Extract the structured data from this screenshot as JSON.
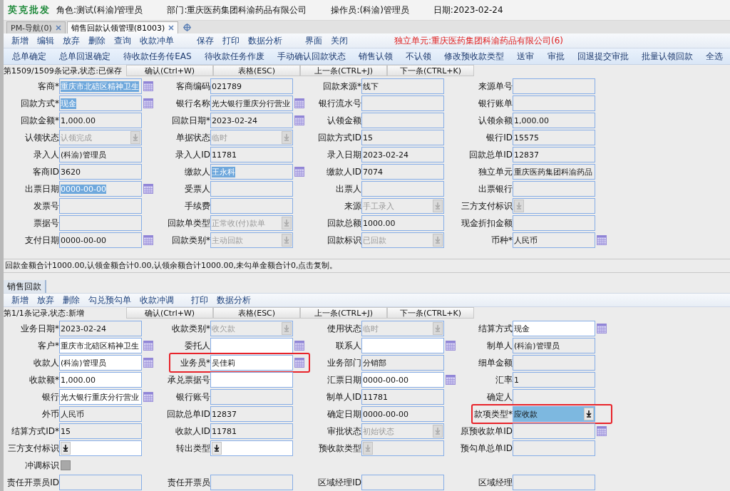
{
  "header": {
    "brand": "英克批发",
    "items": [
      "角色:测试(科渝)管理员",
      "部门:重庆医药集团科渝药品有限公司",
      "操作员:(科渝)管理员",
      "日期:2023-02-24"
    ]
  },
  "tabs": [
    {
      "label": "PM-导航(0)",
      "selected": false
    },
    {
      "label": "销售回款认领管理(81003)",
      "selected": true
    }
  ],
  "toolbar": {
    "groups": [
      [
        "新增",
        "编辑",
        "放弃",
        "删除",
        "查询",
        "收款冲单"
      ],
      [
        "保存",
        "打印",
        "数据分析"
      ],
      [
        "界面",
        "关闭"
      ]
    ],
    "notice": "独立单元:重庆医药集团科渝药品有限公司(6)"
  },
  "actions": [
    "总单确定",
    "总单回退确定",
    "待收款任务传EAS",
    "待收款任务作废",
    "手动确认回款状态",
    "销售认领",
    "不认领",
    "修改预收款类型",
    "送审",
    "审批",
    "回退提交审批",
    "批量认领回款",
    "全选"
  ],
  "record_bar": {
    "status": "第1509/1509条记录,状态:已保存",
    "buttons": [
      "确认(Ctrl+W)",
      "表格(ESC)",
      "上一条(CTRL+J)",
      "下一条(CTRL+K)"
    ]
  },
  "upper_form": {
    "rows": [
      [
        {
          "label": "客商*",
          "value": "重庆市北碚区精神卫生",
          "kind": "text",
          "editable": false,
          "highlighted": true,
          "picker": true
        },
        {
          "label": "客商编码",
          "value": "021789",
          "kind": "text",
          "editable": false
        },
        {
          "label": "回款来源*",
          "value": "线下",
          "kind": "text",
          "editable": false
        },
        {
          "label": "来源单号",
          "kind": "text",
          "editable": false
        }
      ],
      [
        {
          "label": "回款方式*",
          "value": "现金",
          "kind": "text",
          "editable": false,
          "highlighted": true,
          "picker": true
        },
        {
          "label": "银行名称",
          "value": "光大银行重庆分行营业",
          "kind": "text",
          "editable": false,
          "picker": true
        },
        {
          "label": "银行流水号",
          "kind": "text",
          "editable": false
        },
        {
          "label": "银行账单",
          "kind": "text",
          "editable": false
        }
      ],
      [
        {
          "label": "回款金额*",
          "value": "1,000.00",
          "kind": "text",
          "editable": false
        },
        {
          "label": "回款日期*",
          "value": "2023-02-24",
          "kind": "text",
          "editable": false,
          "picker": true
        },
        {
          "label": "认领金额",
          "kind": "text",
          "editable": false
        },
        {
          "label": "认领余额",
          "value": "1,000.00",
          "kind": "text",
          "editable": false
        }
      ],
      [
        {
          "label": "认领状态",
          "value": "认领完成",
          "kind": "select",
          "editable": false
        },
        {
          "label": "单据状态",
          "value": "临时",
          "kind": "select",
          "editable": false
        },
        {
          "label": "回款方式ID",
          "value": "15",
          "kind": "text",
          "editable": false
        },
        {
          "label": "银行ID",
          "value": "15575",
          "kind": "text",
          "editable": false
        }
      ],
      [
        {
          "label": "录入人",
          "value": "(科渝)管理员",
          "kind": "text",
          "editable": false
        },
        {
          "label": "录入人ID",
          "value": "11781",
          "kind": "text",
          "editable": false
        },
        {
          "label": "录入日期",
          "value": "2023-02-24",
          "kind": "text",
          "editable": false
        },
        {
          "label": "回款总单ID",
          "value": "12837",
          "kind": "text",
          "editable": false
        }
      ],
      [
        {
          "label": "客商ID",
          "value": "3620",
          "kind": "text",
          "editable": false
        },
        {
          "label": "缴款人",
          "value": "王永科",
          "kind": "text",
          "editable": false,
          "highlighted": true,
          "picker": true
        },
        {
          "label": "缴款人ID",
          "value": "7074",
          "kind": "text",
          "editable": false
        },
        {
          "label": "独立单元",
          "value": "重庆医药集团科渝药品",
          "kind": "text",
          "editable": false
        }
      ],
      [
        {
          "label": "出票日期",
          "value": "0000-00-00",
          "kind": "text",
          "editable": false,
          "highlighted": true,
          "picker": true
        },
        {
          "label": "受票人",
          "kind": "text",
          "editable": false
        },
        {
          "label": "出票人",
          "kind": "text",
          "editable": false
        },
        {
          "label": "出票银行",
          "kind": "text",
          "editable": false
        }
      ],
      [
        {
          "label": "发票号",
          "kind": "text",
          "editable": false
        },
        {
          "label": "手续费",
          "kind": "text",
          "editable": false
        },
        {
          "label": "来源",
          "value": "手工录入",
          "kind": "select",
          "editable": false
        },
        {
          "label": "三方支付标识",
          "kind": "select",
          "editable": false
        }
      ],
      [
        {
          "label": "票据号",
          "kind": "text",
          "editable": false
        },
        {
          "label": "回款单类型",
          "value": "正常收(付)款单",
          "kind": "select",
          "editable": false
        },
        {
          "label": "回款总额",
          "value": "1000.00",
          "kind": "text",
          "editable": false
        },
        {
          "label": "现金折扣金额",
          "kind": "text",
          "editable": false
        }
      ],
      [
        {
          "label": "支付日期",
          "value": "0000-00-00",
          "kind": "text",
          "editable": false,
          "picker": true
        },
        {
          "label": "回款类别*",
          "value": "主动回款",
          "kind": "select",
          "editable": false
        },
        {
          "label": "回款标识",
          "value": "已回款",
          "kind": "select",
          "editable": false
        },
        {
          "label": "币种*",
          "value": "人民币",
          "kind": "text",
          "editable": false,
          "picker": true
        }
      ]
    ]
  },
  "summary": "回款金额合计1000.00,认领金额合计0.00,认领余额合计1000.00,未勾单金额合计0,点击复制。",
  "lower_tabs": [
    {
      "label": "销售回款",
      "selected": true
    }
  ],
  "lower_toolbar": {
    "groups": [
      [
        "新增",
        "放弃",
        "删除",
        "勾兑预勾单",
        "收款冲调"
      ],
      [
        "打印",
        "数据分析"
      ]
    ]
  },
  "lower_record_bar": {
    "status": "第1/1条记录,状态:新增",
    "buttons": [
      "确认(Ctrl+W)",
      "表格(ESC)",
      "上一条(CTRL+J)",
      "下一条(CTRL+K)"
    ]
  },
  "lower_form": {
    "rows": [
      [
        {
          "label": "业务日期*",
          "value": "2023-02-24",
          "kind": "text",
          "editable": false
        },
        {
          "label": "收款类别*",
          "value": "收欠款",
          "kind": "select",
          "editable": false
        },
        {
          "label": "使用状态",
          "value": "临时",
          "kind": "select",
          "editable": false
        },
        {
          "label": "结算方式",
          "value": "现金",
          "kind": "text",
          "editable": true,
          "picker": true
        }
      ],
      [
        {
          "label": "客户*",
          "value": "重庆市北碚区精神卫生",
          "kind": "text",
          "editable": true,
          "picker": true
        },
        {
          "label": "委托人",
          "kind": "text",
          "editable": true,
          "picker": true
        },
        {
          "label": "联系人",
          "kind": "text",
          "editable": true,
          "picker": true
        },
        {
          "label": "制单人",
          "value": "(科渝)管理员",
          "kind": "text",
          "editable": false
        }
      ],
      [
        {
          "label": "收款人",
          "value": "(科渝)管理员",
          "kind": "text",
          "editable": true,
          "picker": true
        },
        {
          "label": "业务员*",
          "value": "吴佳莉",
          "kind": "text",
          "editable": true,
          "picker": true,
          "callout": true
        },
        {
          "label": "业务部门",
          "value": "分销部",
          "kind": "text",
          "editable": false
        },
        {
          "label": "细单金额",
          "kind": "text",
          "editable": false
        }
      ],
      [
        {
          "label": "收款额*",
          "value": "1,000.00",
          "kind": "text",
          "editable": true
        },
        {
          "label": "承兑票据号",
          "kind": "text",
          "editable": true
        },
        {
          "label": "汇票日期",
          "value": "0000-00-00",
          "kind": "text",
          "editable": true,
          "picker": true
        },
        {
          "label": "汇率",
          "value": "1",
          "kind": "text",
          "editable": false
        }
      ],
      [
        {
          "label": "银行",
          "value": "光大银行重庆分行营业",
          "kind": "text",
          "editable": true,
          "picker": true
        },
        {
          "label": "银行账号",
          "kind": "text",
          "editable": false
        },
        {
          "label": "制单人ID",
          "value": "11781",
          "kind": "text",
          "editable": false
        },
        {
          "label": "确定人",
          "kind": "text",
          "editable": false
        }
      ],
      [
        {
          "label": "外币",
          "value": "人民币",
          "kind": "text",
          "editable": false
        },
        {
          "label": "回款总单ID",
          "value": "12837",
          "kind": "text",
          "editable": false
        },
        {
          "label": "确定日期",
          "value": "0000-00-00",
          "kind": "text",
          "editable": false
        },
        {
          "label": "款项类型*",
          "value": "应收款",
          "kind": "select",
          "editable": true,
          "focused": true,
          "callout": true
        }
      ],
      [
        {
          "label": "结算方式ID*",
          "value": "15",
          "kind": "text",
          "editable": false
        },
        {
          "label": "收款人ID",
          "value": "11781",
          "kind": "text",
          "editable": false
        },
        {
          "label": "审批状态",
          "value": "初始状态",
          "kind": "select",
          "editable": false
        },
        {
          "label": "原预收款单ID",
          "kind": "text",
          "editable": false,
          "picker": true
        }
      ],
      [
        {
          "label": "三方支付标识",
          "kind": "select",
          "editable": true
        },
        {
          "label": "转出类型",
          "kind": "select",
          "editable": true
        },
        {
          "label": "预收款类型",
          "kind": "select",
          "editable": false
        },
        {
          "label": "预勾单总单ID",
          "kind": "text",
          "editable": false
        }
      ],
      [
        {
          "label": "冲调标识",
          "kind": "check",
          "checked": false
        }
      ],
      [
        {
          "label": "责任开票员ID",
          "kind": "text",
          "editable": false
        },
        {
          "label": "责任开票员",
          "kind": "text",
          "editable": false
        },
        {
          "label": "区域经理ID",
          "kind": "text",
          "editable": false
        },
        {
          "label": "区域经理",
          "kind": "text",
          "editable": false
        }
      ]
    ]
  }
}
